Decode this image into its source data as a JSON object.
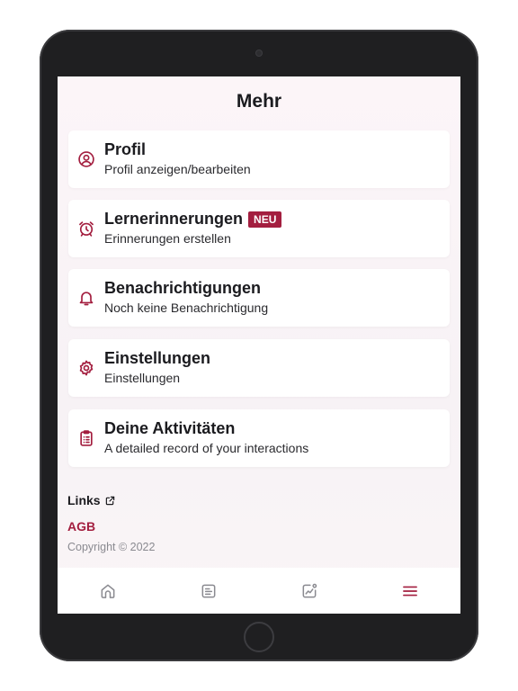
{
  "header": {
    "title": "Mehr"
  },
  "menu": [
    {
      "icon": "user-circle-icon",
      "title": "Profil",
      "subtitle": "Profil anzeigen/bearbeiten"
    },
    {
      "icon": "alarm-clock-icon",
      "title": "Lernerinnerungen",
      "badge": "NEU",
      "subtitle": "Erinnerungen erstellen"
    },
    {
      "icon": "bell-icon",
      "title": "Benachrichtigungen",
      "subtitle": "Noch keine Benachrichtigung"
    },
    {
      "icon": "gear-icon",
      "title": "Einstellungen",
      "subtitle": "Einstellungen"
    },
    {
      "icon": "clipboard-list-icon",
      "title": "Deine Aktivitäten",
      "subtitle": "A detailed record of your interactions"
    }
  ],
  "footer": {
    "links_label": "Links",
    "agb_label": "AGB",
    "copyright": "Copyright © 2022"
  },
  "tab_bar": {
    "items": [
      {
        "icon": "home-icon",
        "active": false
      },
      {
        "icon": "document-icon",
        "active": false
      },
      {
        "icon": "chart-line-icon",
        "active": false
      },
      {
        "icon": "hamburger-menu-icon",
        "active": true
      }
    ]
  },
  "colors": {
    "accent": "#a31e3f",
    "text": "#1b1b1f",
    "muted": "#8a8a90",
    "tab_inactive": "#8a8a90"
  }
}
